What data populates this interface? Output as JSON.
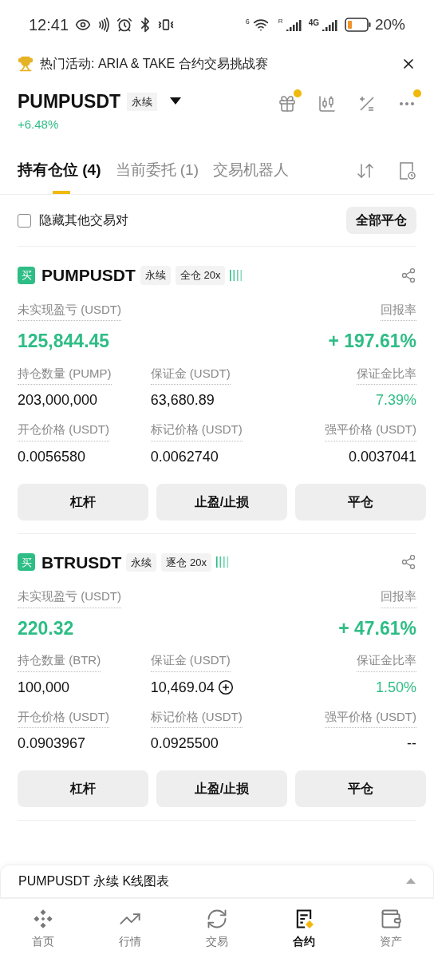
{
  "status_bar": {
    "time": "12:41",
    "wifi_label": "6",
    "roaming_label": "R",
    "network_label": "4G",
    "battery": "20%"
  },
  "banner": {
    "text": "热门活动: ARIA & TAKE 合约交易挑战赛"
  },
  "header": {
    "symbol": "PUMPUSDT",
    "tag": "永续",
    "change": "+6.48%",
    "icons": [
      {
        "kind": "gift",
        "dot": true
      },
      {
        "kind": "candles",
        "dot": false
      },
      {
        "kind": "calc",
        "dot": false
      },
      {
        "kind": "more",
        "dot": true
      }
    ]
  },
  "tabs": [
    {
      "label": "持有仓位 (4)",
      "selected": true
    },
    {
      "label": "当前委托 (1)",
      "selected": false
    },
    {
      "label": "交易机器人",
      "selected": false
    }
  ],
  "filter": {
    "label": "隐藏其他交易对",
    "checked": false,
    "button": "全部平仓"
  },
  "positions": [
    {
      "side": "买",
      "symbol": "PUMPUSDT",
      "tags": [
        "永续",
        "全仓 20x"
      ],
      "pnl": {
        "label": "未实现盈亏 (USDT)",
        "value": "125,844.45"
      },
      "roe": {
        "label": "回报率",
        "value": "+ 197.61%"
      },
      "stats": [
        {
          "label": "持仓数量 (PUMP)",
          "value": "203,000,000",
          "kind": "plain",
          "add": false
        },
        {
          "label": "保证金 (USDT)",
          "value": "63,680.89",
          "kind": "plain",
          "add": false
        },
        {
          "label": "保证金比率",
          "value": "7.39%",
          "kind": "positive",
          "add": false
        },
        {
          "label": "开仓价格 (USDT)",
          "value": "0.0056580",
          "kind": "plain",
          "add": false
        },
        {
          "label": "标记价格 (USDT)",
          "value": "0.0062740",
          "kind": "plain",
          "add": false
        },
        {
          "label": "强平价格 (USDT)",
          "value": "0.0037041",
          "kind": "plain",
          "add": false
        }
      ],
      "buttons": [
        "杠杆",
        "止盈/止损",
        "平仓"
      ]
    },
    {
      "side": "买",
      "symbol": "BTRUSDT",
      "tags": [
        "永续",
        "逐仓 20x"
      ],
      "pnl": {
        "label": "未实现盈亏 (USDT)",
        "value": "220.32"
      },
      "roe": {
        "label": "回报率",
        "value": "+ 47.61%"
      },
      "stats": [
        {
          "label": "持仓数量 (BTR)",
          "value": "100,000",
          "kind": "plain",
          "add": false
        },
        {
          "label": "保证金 (USDT)",
          "value": "10,469.04",
          "kind": "plain",
          "add": true
        },
        {
          "label": "保证金比率",
          "value": "1.50%",
          "kind": "positive",
          "add": false
        },
        {
          "label": "开仓价格 (USDT)",
          "value": "0.0903967",
          "kind": "plain",
          "add": false
        },
        {
          "label": "标记价格 (USDT)",
          "value": "0.0925500",
          "kind": "plain",
          "add": false
        },
        {
          "label": "强平价格 (USDT)",
          "value": "--",
          "kind": "plain",
          "add": false
        }
      ],
      "buttons": [
        "杠杆",
        "止盈/止损",
        "平仓"
      ]
    }
  ],
  "chart_bar": {
    "title": "PUMPUSDT 永续 K线图表",
    "expanded": false
  },
  "nav": [
    {
      "label": "首页",
      "kind": "home",
      "selected": false
    },
    {
      "label": "行情",
      "kind": "markets",
      "selected": false
    },
    {
      "label": "交易",
      "kind": "trade",
      "selected": false
    },
    {
      "label": "合约",
      "kind": "futures",
      "selected": true
    },
    {
      "label": "资产",
      "kind": "assets",
      "selected": false
    }
  ]
}
